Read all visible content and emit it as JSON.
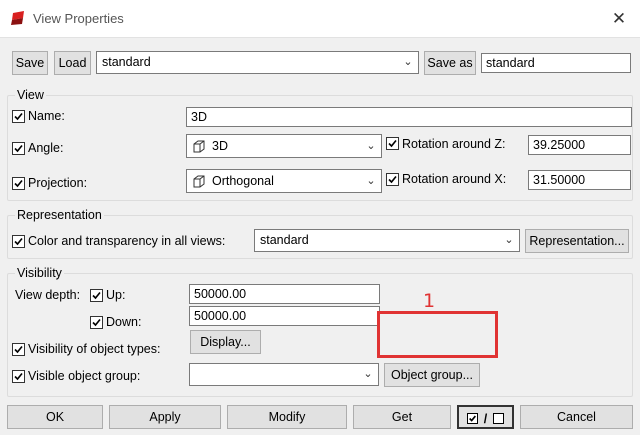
{
  "window": {
    "title": "View Properties",
    "close_symbol": "✕"
  },
  "toolbar": {
    "save_label": "Save",
    "load_label": "Load",
    "preset_value": "standard",
    "save_as_label": "Save as",
    "save_as_value": "standard"
  },
  "view": {
    "group_label": "View",
    "name_label": "Name:",
    "name_value": "3D",
    "angle_label": "Angle:",
    "angle_value": "3D",
    "projection_label": "Projection:",
    "projection_value": "Orthogonal",
    "rot_z_label": "Rotation around Z:",
    "rot_z_value": "39.25000",
    "rot_x_label": "Rotation around X:",
    "rot_x_value": "31.50000"
  },
  "representation": {
    "group_label": "Representation",
    "color_label": "Color and transparency in all views:",
    "color_value": "standard",
    "button_label": "Representation..."
  },
  "visibility": {
    "group_label": "Visibility",
    "depth_label": "View depth:",
    "up_label": "Up:",
    "up_value": "50000.00",
    "down_label": "Down:",
    "down_value": "50000.00",
    "types_label": "Visibility of object types:",
    "display_label": "Display...",
    "group_obj_label": "Visible object group:",
    "group_obj_value": "",
    "object_group_label": "Object group..."
  },
  "annotation": {
    "number": "1",
    "color": "#e03333"
  },
  "footer": {
    "ok_label": "OK",
    "apply_label": "Apply",
    "modify_label": "Modify",
    "get_label": "Get",
    "toggle_label": "/",
    "cancel_label": "Cancel"
  },
  "colors": {
    "dialog_bg": "#f0f0f0",
    "button_bg": "#e1e1e1",
    "annotation": "#e03333"
  }
}
